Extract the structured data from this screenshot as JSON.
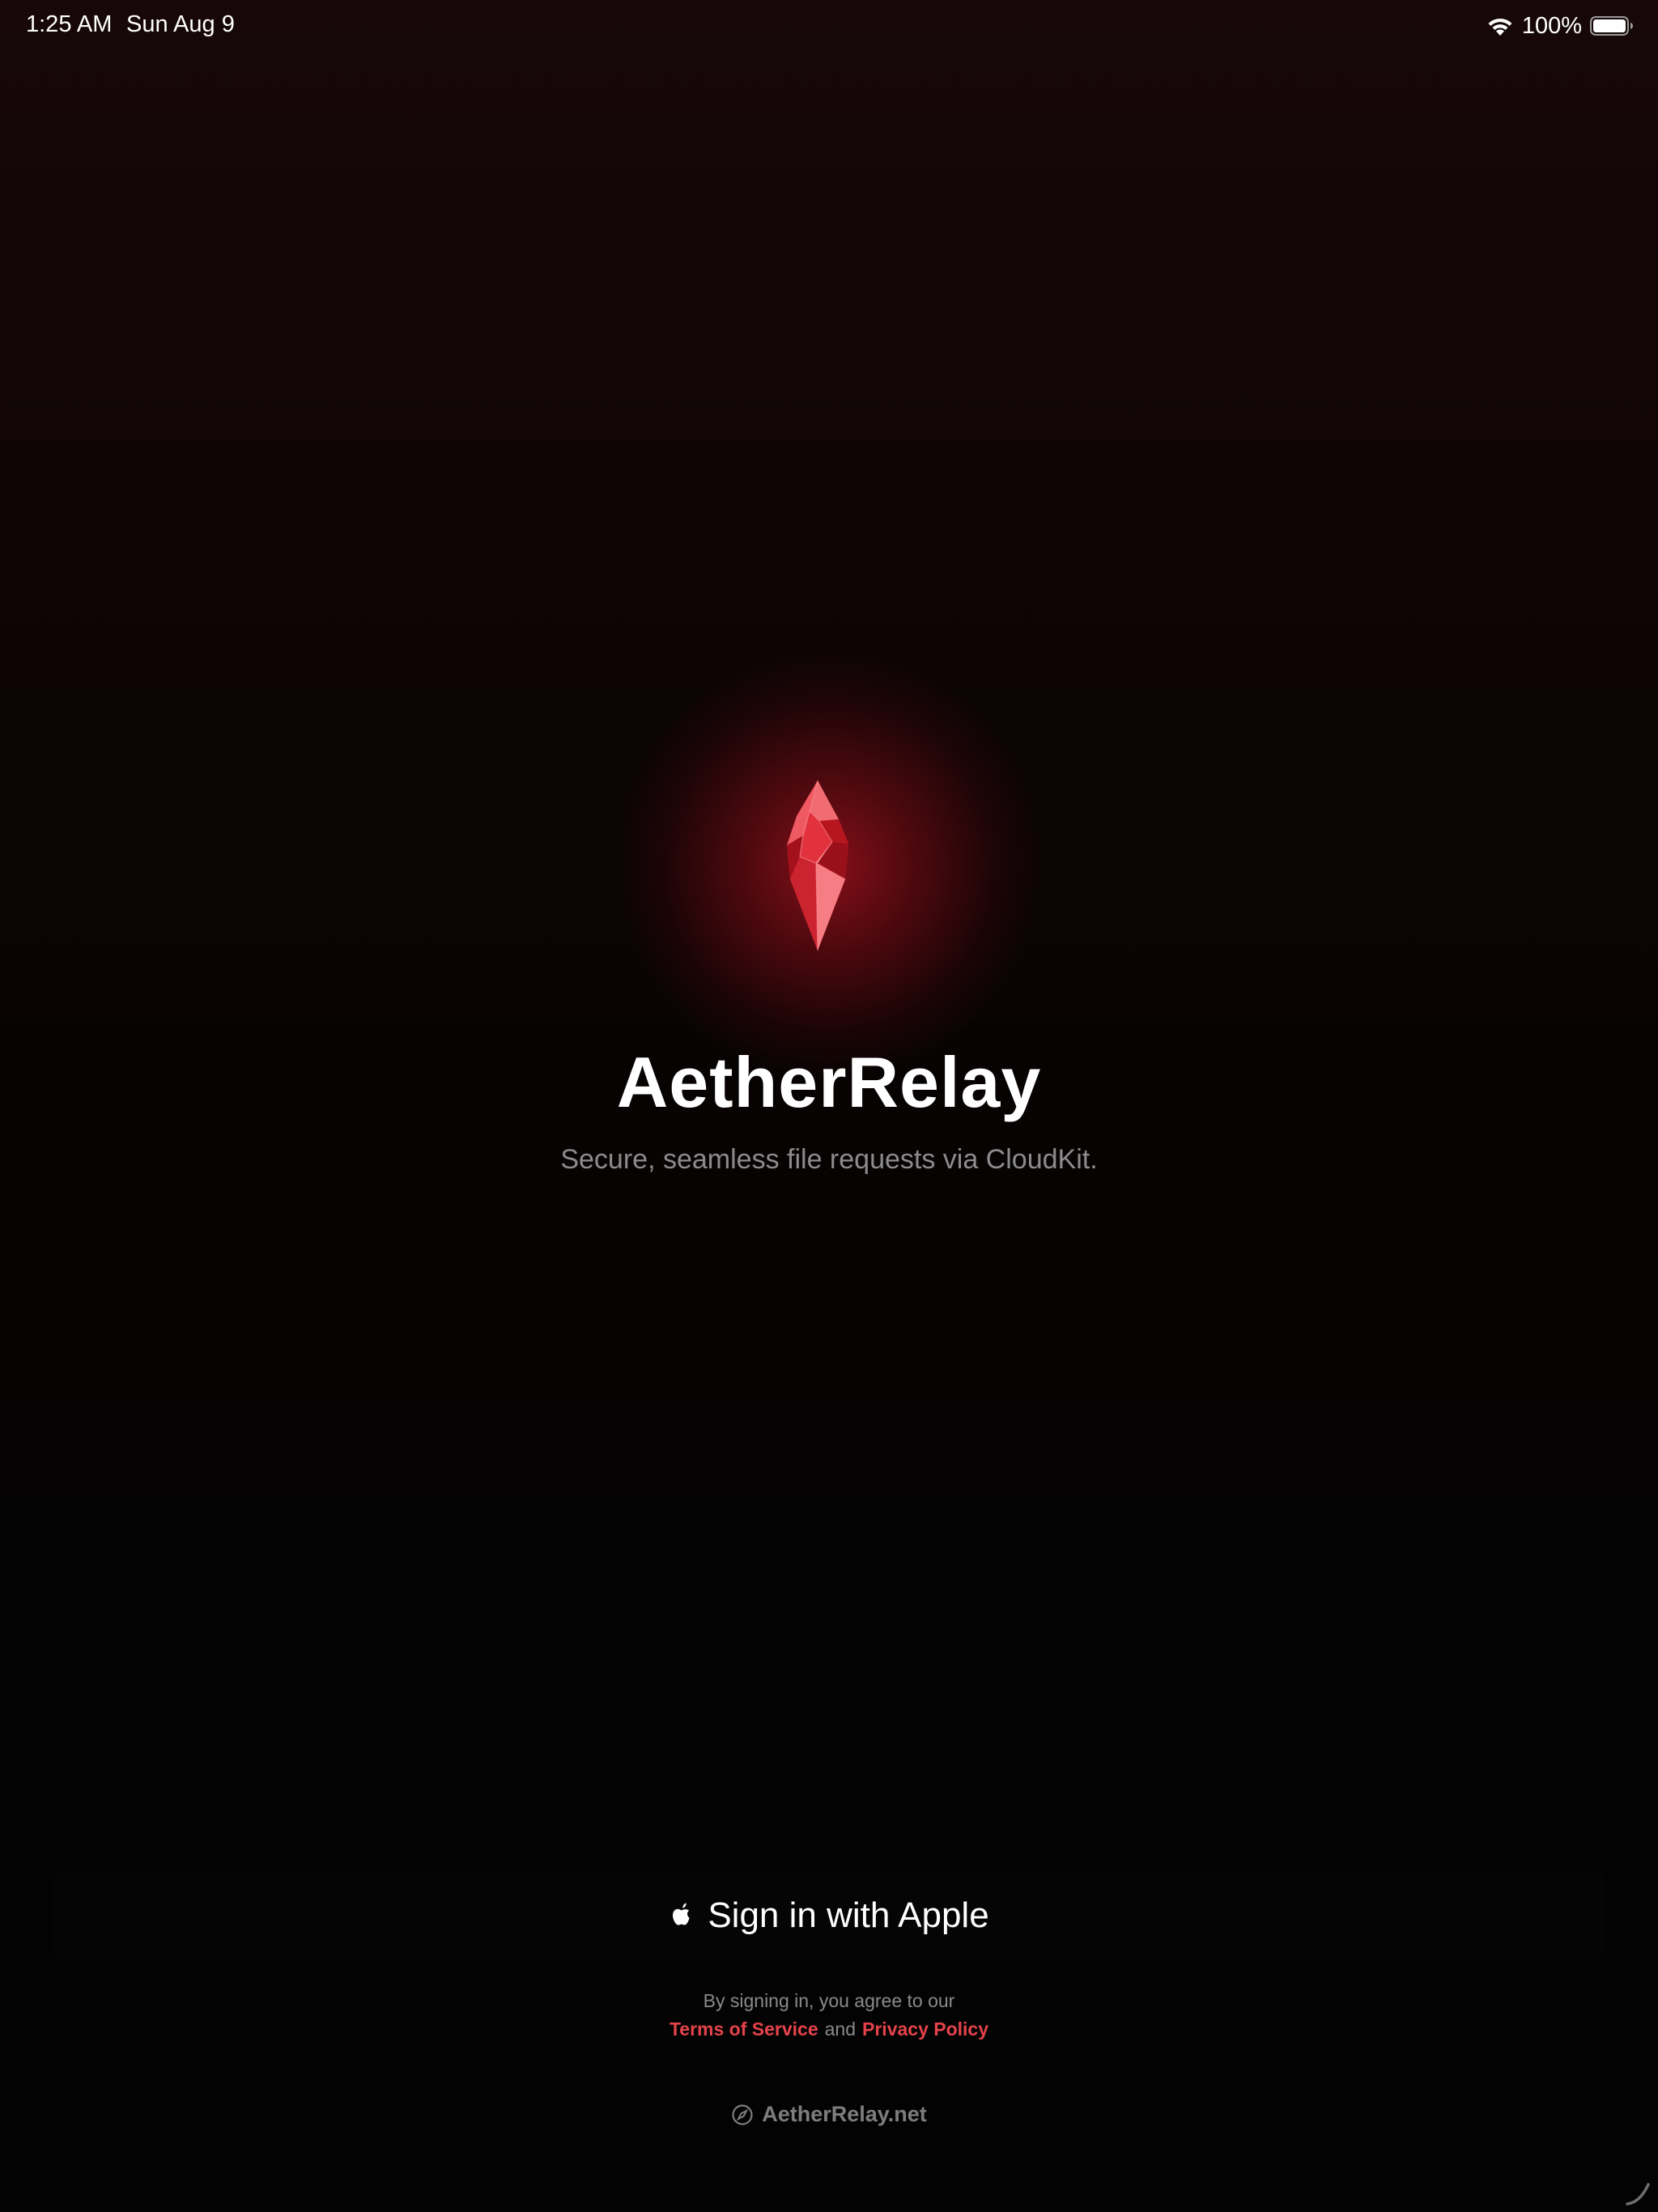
{
  "status_bar": {
    "time": "1:25 AM",
    "date": "Sun Aug 9",
    "battery_percent": "100%",
    "battery_level": 1.0,
    "icons": [
      "wifi-icon",
      "battery-icon"
    ]
  },
  "hero": {
    "icon": "red-crystal-icon",
    "title": "AetherRelay",
    "subtitle": "Secure, seamless file requests via CloudKit."
  },
  "signin": {
    "icon": "apple-logo-icon",
    "label": "Sign in with Apple"
  },
  "legal": {
    "line1": "By signing in, you agree to our",
    "terms_label": "Terms of Service",
    "and_text": "and",
    "privacy_label": "Privacy Policy"
  },
  "footer": {
    "icon": "compass-icon",
    "website_label": "AetherRelay.net"
  },
  "colors": {
    "accent": "#E5434B",
    "crystal_red": "#E02A38",
    "background": "#050303",
    "subtitle_gray": "#8C8C8C"
  }
}
